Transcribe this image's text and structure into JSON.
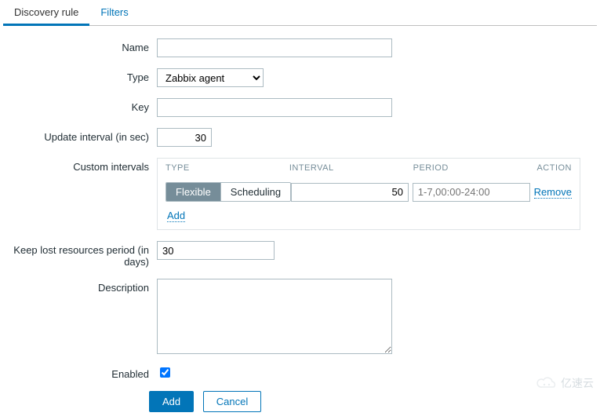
{
  "tabs": {
    "discovery_rule": "Discovery rule",
    "filters": "Filters"
  },
  "labels": {
    "name": "Name",
    "type": "Type",
    "key": "Key",
    "update_interval": "Update interval (in sec)",
    "custom_intervals": "Custom intervals",
    "keep_lost": "Keep lost resources period (in days)",
    "description": "Description",
    "enabled": "Enabled"
  },
  "values": {
    "name": "",
    "type_selected": "Zabbix agent",
    "key": "",
    "update_interval": "30",
    "keep_lost": "30",
    "description": "",
    "enabled": true
  },
  "custom_intervals": {
    "headers": {
      "type": "TYPE",
      "interval": "INTERVAL",
      "period": "PERIOD",
      "action": "ACTION"
    },
    "row": {
      "seg_flexible": "Flexible",
      "seg_scheduling": "Scheduling",
      "interval_value": "50",
      "period_placeholder": "1-7,00:00-24:00",
      "remove": "Remove"
    },
    "add": "Add"
  },
  "buttons": {
    "add": "Add",
    "cancel": "Cancel"
  },
  "watermark": "亿速云"
}
